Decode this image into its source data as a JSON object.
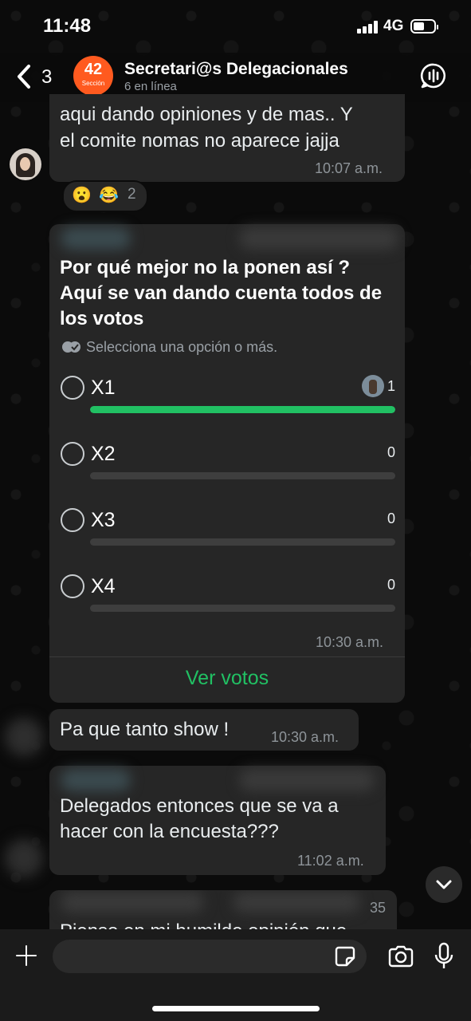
{
  "status_bar": {
    "time": "11:48",
    "network": "4G"
  },
  "header": {
    "back_count": "3",
    "group_avatar_number": "42",
    "group_avatar_text": "Sección",
    "title": "Secretari@s Delegacionales",
    "subtitle": "6 en línea"
  },
  "messages": [
    {
      "text_lines": [
        "aqui dando opiniones y de mas.. Y",
        "el comite nomas no aparece jajja"
      ],
      "time": "10:07 a.m.",
      "reactions": {
        "emojis": [
          "😮",
          "😂"
        ],
        "count": "2"
      }
    },
    {
      "type": "poll",
      "question": "Por qué mejor no la ponen así ? Aquí se van dando cuenta todos de los votos",
      "hint": "Selecciona una opción o más.",
      "options": [
        {
          "label": "X1",
          "votes": "1",
          "fraction": 1.0
        },
        {
          "label": "X2",
          "votes": "0",
          "fraction": 0
        },
        {
          "label": "X3",
          "votes": "0",
          "fraction": 0
        },
        {
          "label": "X4",
          "votes": "0",
          "fraction": 0
        }
      ],
      "time": "10:30 a.m.",
      "action": "Ver votos"
    },
    {
      "text": "Pa que  tanto show !",
      "time": "10:30 a.m."
    },
    {
      "text_lines": [
        "Delegados entonces que se va a",
        "hacer con la encuesta???"
      ],
      "time": "11:02 a.m."
    },
    {
      "partial_text": "Pienso en mi humilde opinión que",
      "partial_meta": "35"
    }
  ],
  "colors": {
    "accent": "#21c063",
    "bubble": "#262626",
    "background": "#0b0b0b"
  }
}
